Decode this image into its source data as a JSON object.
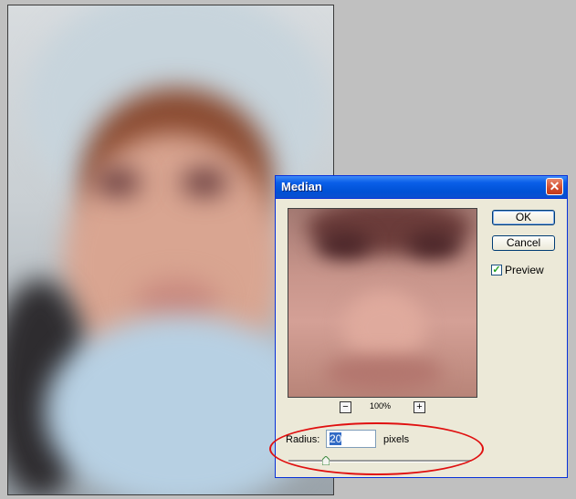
{
  "dialog": {
    "title": "Median",
    "close_symbol": "✕",
    "ok_label": "OK",
    "cancel_label": "Cancel",
    "preview_label": "Preview",
    "preview_checked": true,
    "zoom_level": "100%",
    "zoom_out_symbol": "−",
    "zoom_in_symbol": "+",
    "radius_label": "Radius:",
    "radius_value": "20",
    "radius_units": "pixels"
  },
  "colors": {
    "annotation": "#e01010",
    "titlebar": "#0a5fe8"
  }
}
